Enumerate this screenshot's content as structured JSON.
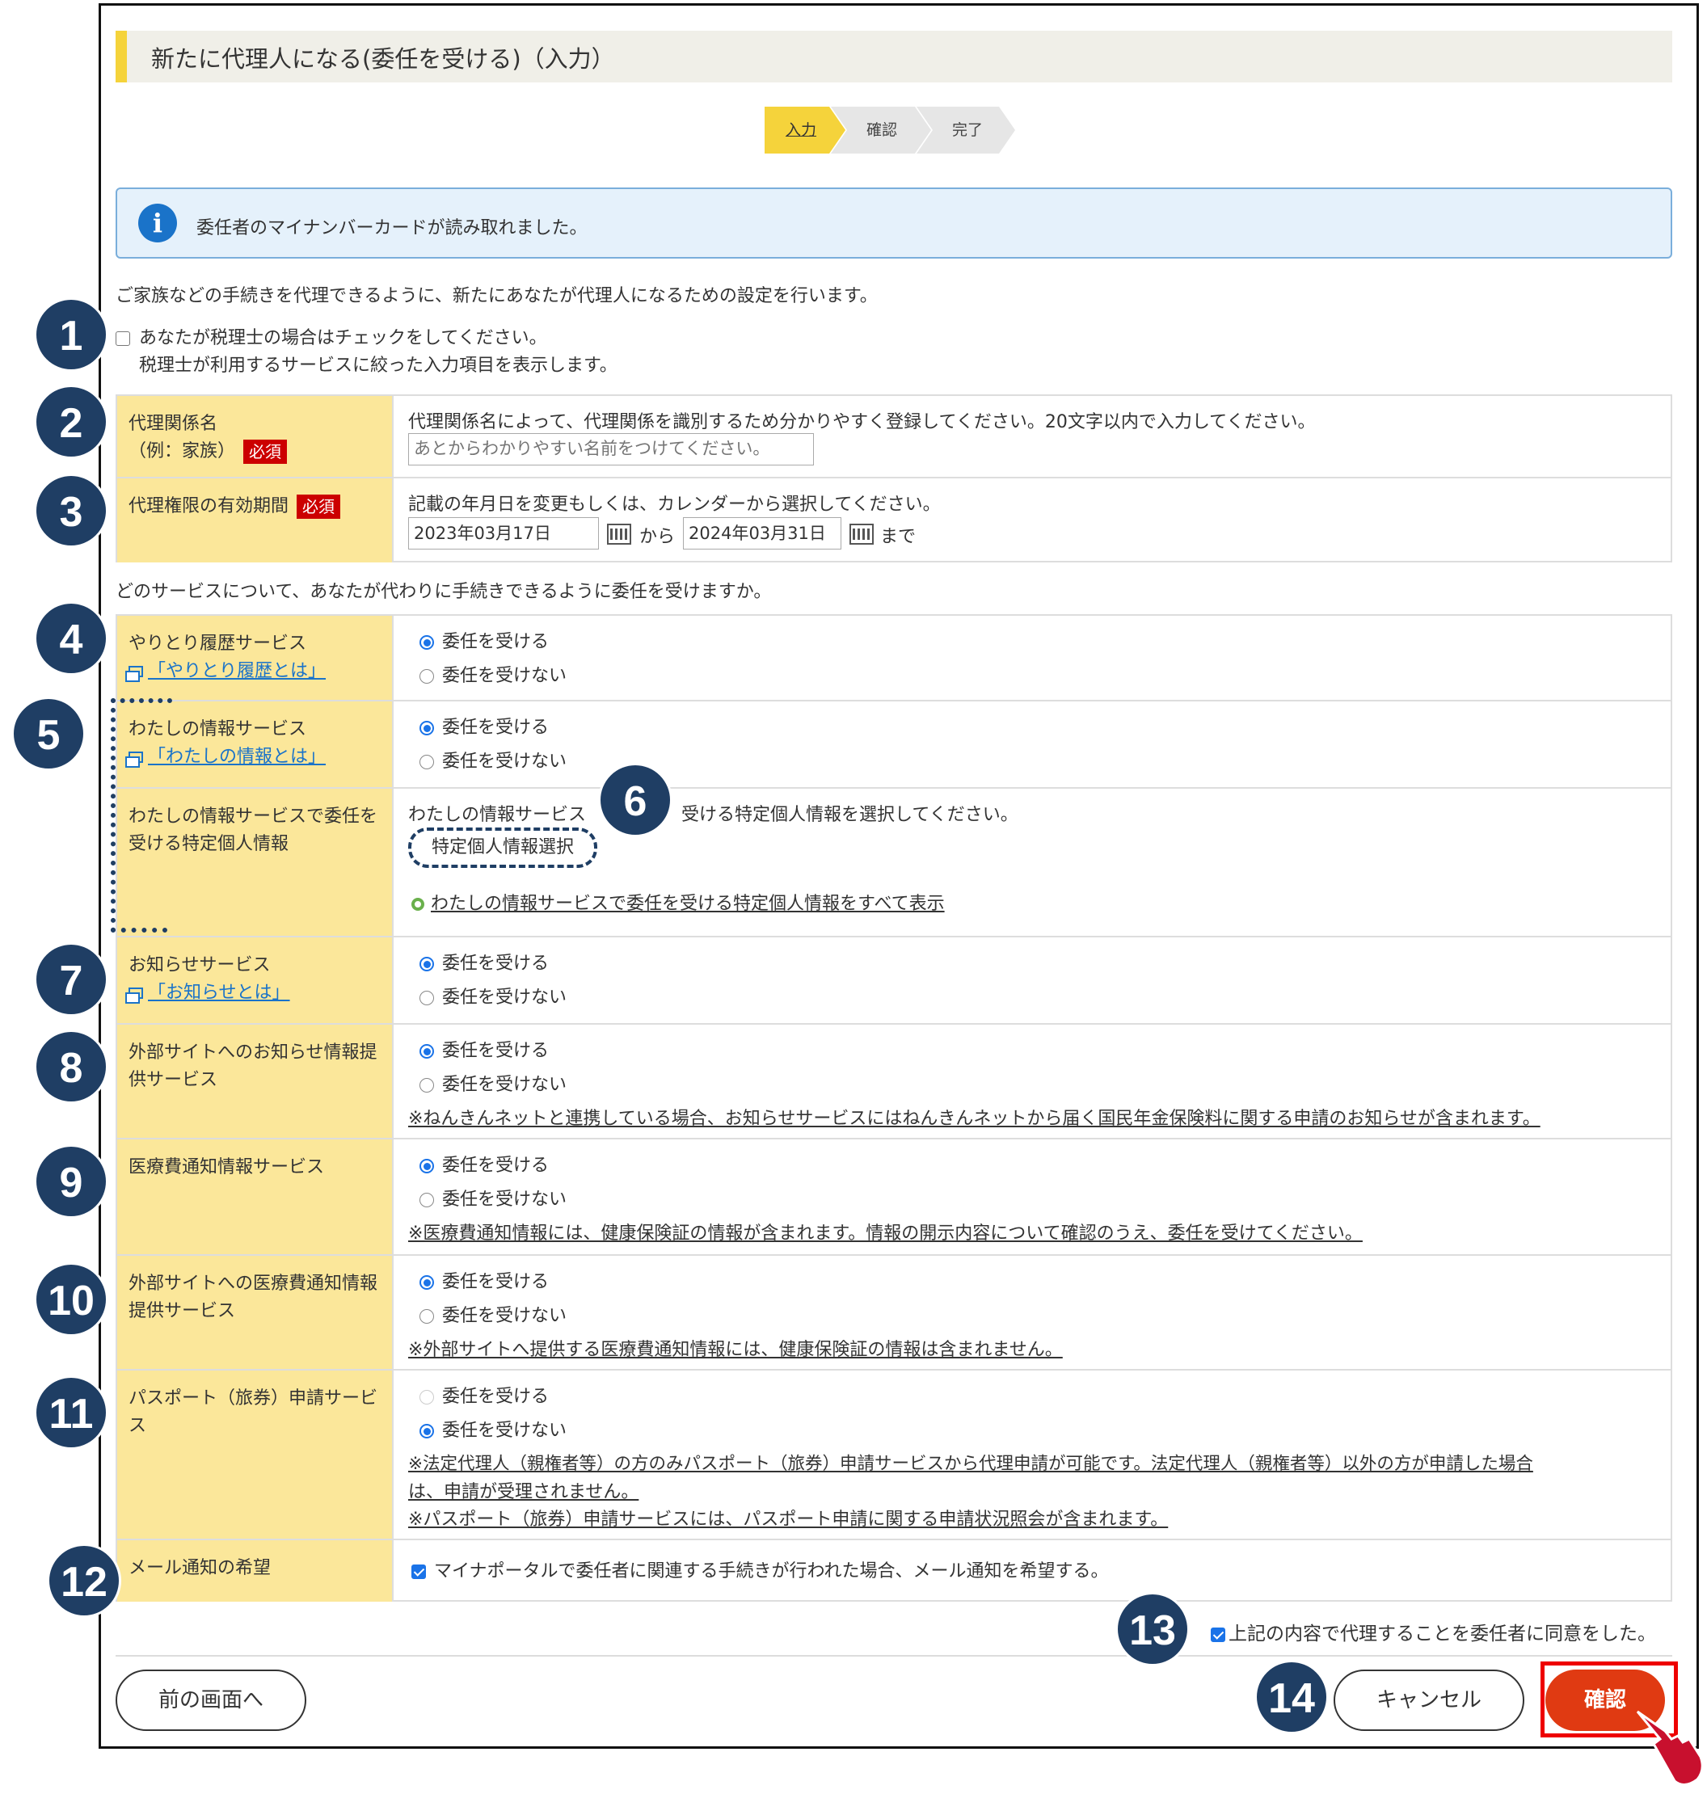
{
  "title": "新たに代理人になる(委任を受ける)（入力）",
  "steps": [
    "入力",
    "確認",
    "完了"
  ],
  "info_message": "委任者のマイナンバーカードが読み取れました。",
  "intro": "ご家族などの手続きを代理できるように、新たにあなたが代理人になるための設定を行います。",
  "tax_accountant_check": "あなたが税理士の場合はチェックをしてください。",
  "tax_accountant_note": "税理士が利用するサービスに絞った入力項目を表示します。",
  "required": "必須",
  "relation": {
    "label1": "代理関係名",
    "label2": "（例：家族）",
    "desc": "代理関係名によって、代理関係を識別するため分かりやすく登録してください。20文字以内で入力してください。",
    "placeholder": "あとからわかりやすい名前をつけてください。"
  },
  "period": {
    "label": "代理権限の有効期間",
    "desc": "記載の年月日を変更もしくは、カレンダーから選択してください。",
    "from": "2023年03月17日",
    "from_suffix": "から",
    "to": "2024年03月31日",
    "to_suffix": "まで"
  },
  "services_question": "どのサービスについて、あなたが代わりに手続きできるように委任を受けますか。",
  "accept": "委任を受ける",
  "decline": "委任を受けない",
  "history": {
    "label": "やりとり履歴サービス",
    "link": "「やりとり履歴とは」"
  },
  "myinfo": {
    "label": "わたしの情報サービス",
    "link": "「わたしの情報とは」"
  },
  "specific": {
    "label": "わたしの情報サービスで委任を受ける特定個人情報",
    "desc_a": "わたしの情報サービス",
    "desc_b": "受ける特定個人情報を選択してください。",
    "button": "特定個人情報選択",
    "show_all": "わたしの情報サービスで委任を受ける特定個人情報をすべて表示"
  },
  "notice": {
    "label": "お知らせサービス",
    "link": "「お知らせとは」"
  },
  "ext_notice": {
    "label": "外部サイトへのお知らせ情報提供サービス",
    "note": "※ねんきんネットと連携している場合、お知らせサービスにはねんきんネットから届く国民年金保険料に関する申請のお知らせが含まれます。"
  },
  "medical": {
    "label": "医療費通知情報サービス",
    "note": "※医療費通知情報には、健康保険証の情報が含まれます。情報の開示内容について確認のうえ、委任を受けてください。"
  },
  "ext_medical": {
    "label": "外部サイトへの医療費通知情報提供サービス",
    "note": "※外部サイトへ提供する医療費通知情報には、健康保険証の情報は含まれません。"
  },
  "passport": {
    "label": "パスポート（旅券）申請サービス",
    "note1a": "※法定代理人（親権者等）の方のみパスポート（旅券）申請サービスから代理申請が可能です。法定代理人（親権者等）以外の方が申請した場合",
    "note1b": "は、申請が受理されません。",
    "note2": "※パスポート（旅券）申請サービスには、パスポート申請に関する申請状況照会が含まれます。"
  },
  "mail": {
    "label": "メール通知の希望",
    "text": "マイナポータルで委任者に関連する手続きが行われた場合、メール通知を希望する。"
  },
  "consent": "上記の内容で代理することを委任者に同意をした。",
  "buttons": {
    "back": "前の画面へ",
    "cancel": "キャンセル",
    "confirm": "確認"
  },
  "badges": [
    "1",
    "2",
    "3",
    "4",
    "5",
    "6",
    "7",
    "8",
    "9",
    "10",
    "11",
    "12",
    "13",
    "14"
  ],
  "colors": {
    "accent_yellow": "#fbe79a",
    "required_red": "#cc0000",
    "confirm_red": "#e03a12",
    "badge_navy": "#1f3e64",
    "link_blue": "#1a73c9"
  }
}
